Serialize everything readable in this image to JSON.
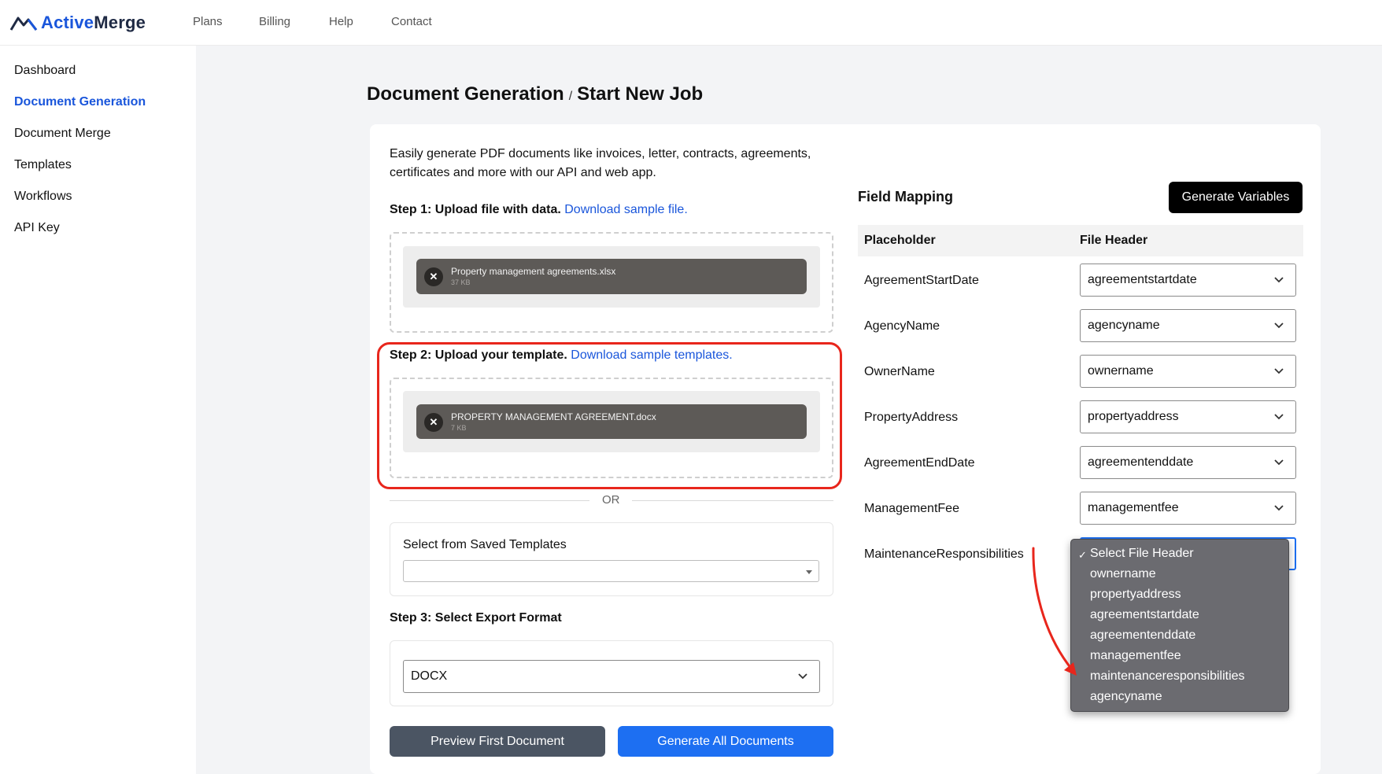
{
  "brand": {
    "part1": "Active",
    "part2": "Merge"
  },
  "nav": [
    "Plans",
    "Billing",
    "Help",
    "Contact"
  ],
  "sidebar": {
    "items": [
      {
        "label": "Dashboard",
        "active": false
      },
      {
        "label": "Document Generation",
        "active": true
      },
      {
        "label": "Document Merge",
        "active": false
      },
      {
        "label": "Templates",
        "active": false
      },
      {
        "label": "Workflows",
        "active": false
      },
      {
        "label": "API Key",
        "active": false
      }
    ]
  },
  "breadcrumb": {
    "parent": "Document Generation",
    "separator": "/",
    "current": "Start New Job"
  },
  "intro": "Easily generate PDF documents like invoices, letter, contracts, agreements, certificates and more with our API and web app.",
  "step1": {
    "label": "Step 1: Upload file with data.",
    "link": "Download sample file.",
    "file": {
      "name": "Property management agreements.xlsx",
      "size": "37 KB"
    }
  },
  "step2": {
    "label": "Step 2: Upload your template.",
    "link": "Download sample templates.",
    "file": {
      "name": "PROPERTY MANAGEMENT AGREEMENT.docx",
      "size": "7 KB"
    }
  },
  "or_text": "OR",
  "saved_templates": {
    "label": "Select from Saved Templates",
    "value": ""
  },
  "step3": {
    "label": "Step 3: Select Export Format",
    "value": "DOCX"
  },
  "buttons": {
    "preview": "Preview First Document",
    "generate_all": "Generate All Documents"
  },
  "field_mapping": {
    "title": "Field Mapping",
    "generate_button": "Generate Variables",
    "col_placeholder": "Placeholder",
    "col_header": "File Header",
    "rows": [
      {
        "placeholder": "AgreementStartDate",
        "header": "agreementstartdate"
      },
      {
        "placeholder": "AgencyName",
        "header": "agencyname"
      },
      {
        "placeholder": "OwnerName",
        "header": "ownername"
      },
      {
        "placeholder": "PropertyAddress",
        "header": "propertyaddress"
      },
      {
        "placeholder": "AgreementEndDate",
        "header": "agreementenddate"
      },
      {
        "placeholder": "ManagementFee",
        "header": "managementfee"
      },
      {
        "placeholder": "MaintenanceResponsibilities",
        "header": ""
      }
    ],
    "dropdown": {
      "selected": "Select File Header",
      "options": [
        "Select File Header",
        "ownername",
        "propertyaddress",
        "agreementstartdate",
        "agreementenddate",
        "managementfee",
        "maintenanceresponsibilities",
        "agencyname"
      ]
    }
  },
  "colors": {
    "accent": "#1a56db",
    "annotation": "#e8261c",
    "preview_button": "#4b5563",
    "primary_button": "#1d6ff2"
  }
}
